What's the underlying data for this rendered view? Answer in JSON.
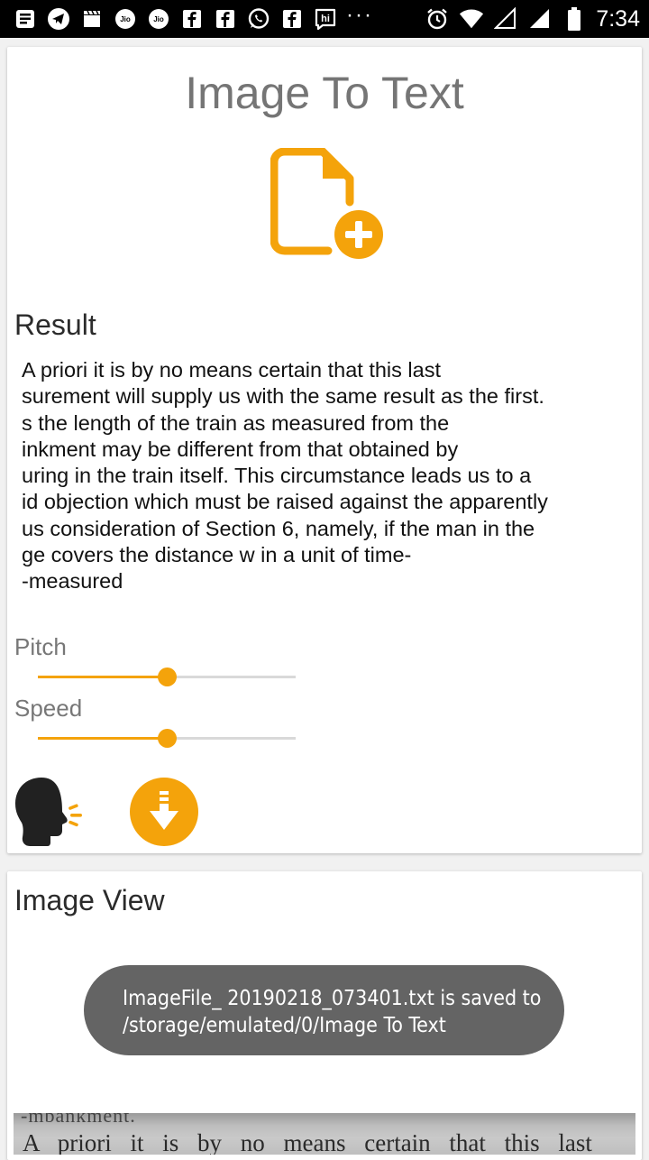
{
  "status_bar": {
    "time": "7:34",
    "overflow_dots": "···",
    "left_icons": [
      "news-icon",
      "telegram-icon",
      "clapper-icon",
      "jio-icon",
      "jio-icon",
      "facebook-icon",
      "facebook-icon",
      "whatsapp-icon",
      "facebook-icon",
      "hike-icon"
    ],
    "right_icons": [
      "alarm-icon",
      "wifi-icon",
      "signal-empty-icon",
      "signal-icon",
      "battery-icon"
    ]
  },
  "main_card": {
    "title": "Image To Text",
    "add_file_icon": "file-add-icon",
    "result_heading": "Result",
    "result_text": "A priori it is by no means certain that this last\nsurement will supply us with the same result as the first.\ns the length of the train as measured from the\ninkment may be different from that obtained by\nuring in the train itself. This circumstance leads us to a\nid objection which must be raised against the apparently\nus consideration of Section 6, namely, if the man in the\nge covers the distance w in a unit of time-\n-measured",
    "pitch_label": "Pitch",
    "pitch_value": 0.5,
    "speed_label": "Speed",
    "speed_value": 0.5,
    "speak_icon": "speaking-head-icon",
    "download_icon": "download-icon"
  },
  "image_card": {
    "heading": "Image View",
    "photo_top_text": "-mbankment.",
    "photo_text": "A priori it is by no means certain that this last"
  },
  "toast": {
    "line1": "ImageFile_ 20190218_073401.txt is saved to",
    "line2": "/storage/emulated/0/Image To Text"
  },
  "colors": {
    "accent": "#f4a30b",
    "title_gray": "#757575",
    "toast_bg": "#646464"
  }
}
